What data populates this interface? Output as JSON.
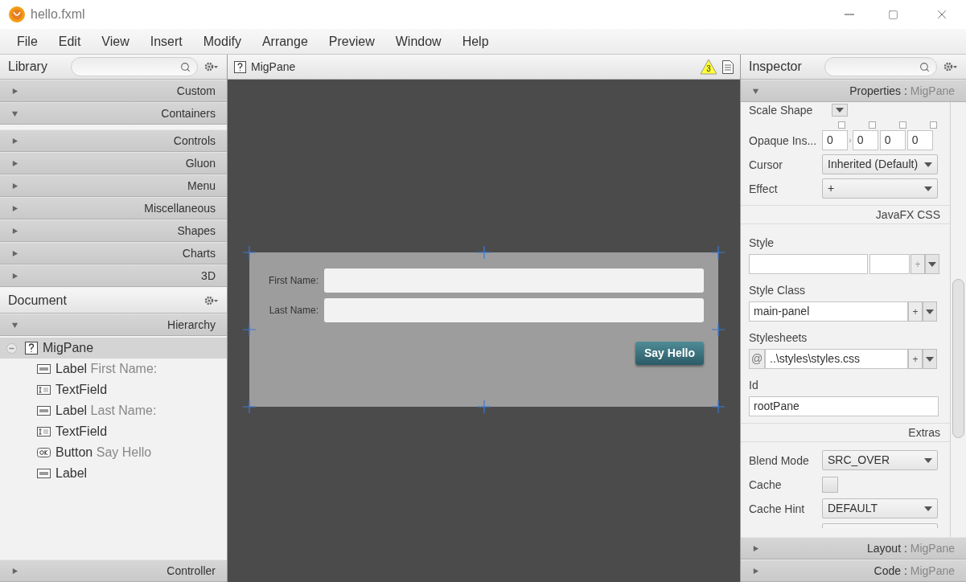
{
  "window": {
    "title": "hello.fxml"
  },
  "menu": [
    "File",
    "Edit",
    "View",
    "Insert",
    "Modify",
    "Arrange",
    "Preview",
    "Window",
    "Help"
  ],
  "library": {
    "title": "Library",
    "sections": [
      {
        "label": "Custom",
        "expanded": false
      },
      {
        "label": "Containers",
        "expanded": true
      },
      {
        "label": "Controls",
        "expanded": false
      },
      {
        "label": "Gluon",
        "expanded": false
      },
      {
        "label": "Menu",
        "expanded": false
      },
      {
        "label": "Miscellaneous",
        "expanded": false
      },
      {
        "label": "Shapes",
        "expanded": false
      },
      {
        "label": "Charts",
        "expanded": false
      },
      {
        "label": "3D",
        "expanded": false
      }
    ]
  },
  "document": {
    "title": "Document",
    "hierarchy": {
      "label": "Hierarchy",
      "expanded": true
    },
    "tree": [
      {
        "kind": "pane",
        "type": "MigPane",
        "selected": true,
        "expanded": true,
        "children": [
          {
            "kind": "label",
            "type": "Label",
            "text": "First Name:",
            "selected": false
          },
          {
            "kind": "textfield",
            "type": "TextField",
            "selected": false
          },
          {
            "kind": "label",
            "type": "Label",
            "text": "Last Name:",
            "selected": false
          },
          {
            "kind": "textfield",
            "type": "TextField",
            "selected": false
          },
          {
            "kind": "button",
            "type": "Button",
            "text": "Say Hello",
            "selected": false
          },
          {
            "kind": "label",
            "type": "Label",
            "selected": false
          }
        ]
      }
    ],
    "controller": {
      "label": "Controller",
      "expanded": false
    }
  },
  "canvas": {
    "title": "MigPane",
    "warnings": "3",
    "form": {
      "fields": [
        {
          "label": "First Name:"
        },
        {
          "label": "Last Name:"
        }
      ],
      "button": "Say Hello"
    }
  },
  "inspector": {
    "title": "Inspector",
    "properties": {
      "title": "Properties :",
      "target": "MigPane",
      "expanded": true,
      "rows": [
        {
          "kind": "partial",
          "label": "Scale Shape"
        },
        {
          "kind": "insets",
          "label": "Opaque Ins...",
          "sep": "›",
          "values": [
            {
              "value": "0",
              "checked": false
            },
            {
              "value": "0",
              "checked": false
            },
            {
              "value": "0",
              "checked": false
            },
            {
              "value": "0",
              "checked": false
            }
          ]
        },
        {
          "kind": "select",
          "label": "Cursor",
          "value": "Inherited (Default)"
        },
        {
          "kind": "select",
          "label": "Effect",
          "value": "+"
        },
        {
          "kind": "group",
          "label": "JavaFX CSS"
        },
        {
          "kind": "style",
          "label": "Style",
          "add": "+"
        },
        {
          "kind": "list",
          "label": "Style Class",
          "value": "main-panel",
          "add": "+"
        },
        {
          "kind": "list",
          "label": "Stylesheets",
          "prefix": "@",
          "value": "..\\styles\\styles.css",
          "add": "+"
        },
        {
          "kind": "text",
          "label": "Id",
          "value": "rootPane"
        },
        {
          "kind": "group",
          "label": "Extras"
        },
        {
          "kind": "select",
          "label": "Blend Mode",
          "value": "SRC_OVER"
        },
        {
          "kind": "checkbox",
          "label": "Cache",
          "checked": false
        },
        {
          "kind": "select",
          "label": "Cache Hint",
          "value": "DEFAULT"
        },
        {
          "kind": "cut"
        }
      ]
    },
    "sections": [
      {
        "title": "Layout :",
        "target": "MigPane",
        "expanded": false
      },
      {
        "title": "Code :",
        "target": "MigPane",
        "expanded": false
      }
    ]
  }
}
